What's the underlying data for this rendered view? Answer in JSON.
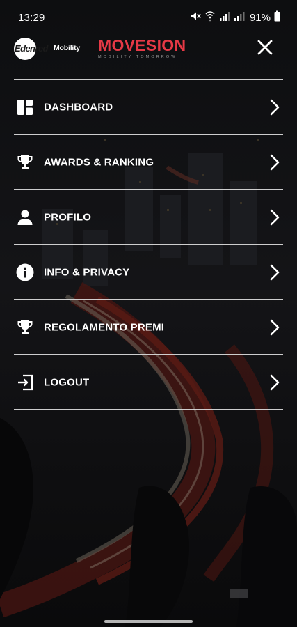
{
  "status_bar": {
    "time": "13:29",
    "battery": "91%",
    "icons": [
      "mute-icon",
      "wifi-calling-icon",
      "signal-icon",
      "signal-icon",
      "battery-icon"
    ]
  },
  "header": {
    "edenred_logo_text": "Edenred",
    "edenred_logo_sub": "Mobility",
    "movesion_logo_text": "MOVESION",
    "movesion_tagline": "MOBILITY TOMORROW",
    "close_icon": "close-icon"
  },
  "menu": {
    "items": [
      {
        "label": "DASHBOARD",
        "icon": "dashboard-icon"
      },
      {
        "label": "AWARDS & RANKING",
        "icon": "trophy-icon"
      },
      {
        "label": "PROFILO",
        "icon": "person-icon"
      },
      {
        "label": "INFO & PRIVACY",
        "icon": "info-icon"
      },
      {
        "label": "REGOLAMENTO PREMI",
        "icon": "trophy-icon"
      },
      {
        "label": "LOGOUT",
        "icon": "logout-icon"
      }
    ]
  },
  "colors": {
    "background": "#0b0b0d",
    "brand_red": "#e63946",
    "text": "#ffffff",
    "divider": "#d8d8d8"
  }
}
